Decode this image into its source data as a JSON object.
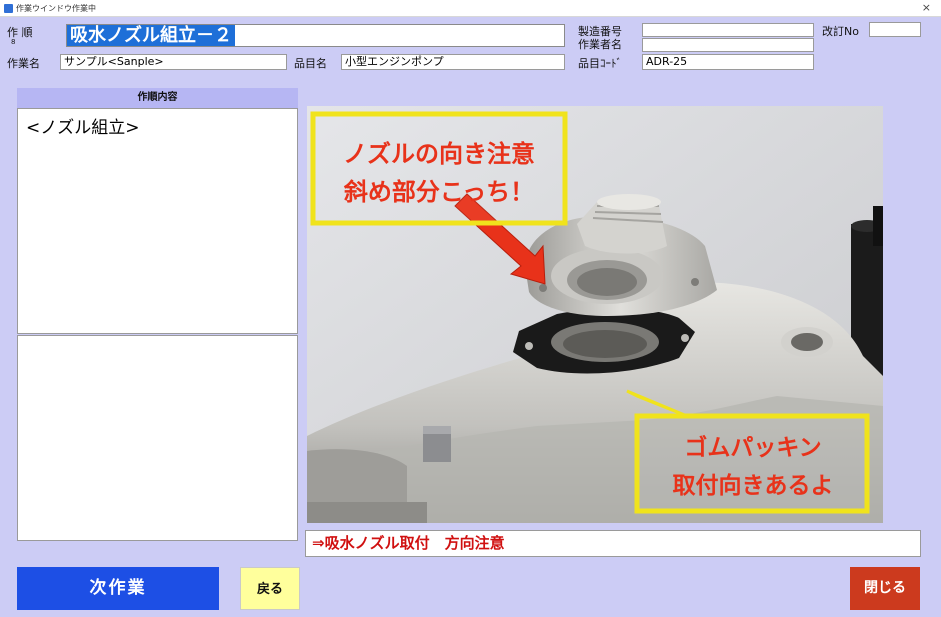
{
  "window": {
    "title": "作業ウインドウ",
    "status": "作業中",
    "close_glyph": "×"
  },
  "header": {
    "step_label": "作 順",
    "step_sub": "8",
    "step_title": "吸水ノズル組立－２",
    "work_name_label": "作業名",
    "work_name_value": "サンプル<Sanple>",
    "item_name_label": "品目名",
    "item_name_value": "小型エンジンポンプ",
    "serial_label": "製造番号",
    "serial_value": "",
    "worker_label": "作業者名",
    "worker_value": "",
    "item_code_label": "品目ｺｰﾄﾞ",
    "item_code_value": "ADR-25",
    "revision_label": "改訂No",
    "revision_value": ""
  },
  "left_panel": {
    "header": "作順内容",
    "content": "<ノズル組立>",
    "notes": ""
  },
  "photo": {
    "callout_top_line1": "ノズルの向き注意",
    "callout_top_line2": "斜め部分こっち！",
    "callout_bottom_line1": "ゴムパッキン",
    "callout_bottom_line2": "取付向きあるよ"
  },
  "caption": "⇒吸水ノズル取付　方向注意",
  "buttons": {
    "next": "次作業",
    "back": "戻る",
    "close": "閉じる"
  },
  "colors": {
    "background": "#ccccf5",
    "accent_blue": "#1d4fe5",
    "back_yellow": "#ffff9c",
    "close_red": "#cc3a1e",
    "callout_border": "#f0e31c",
    "callout_text": "#e8321a"
  }
}
